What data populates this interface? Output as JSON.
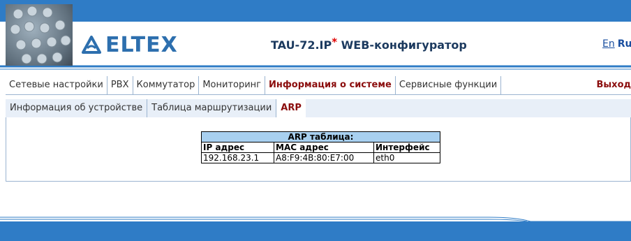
{
  "header": {
    "logo_text": "ELTEX",
    "app_title": "TAU-72.IP",
    "title_star": "*",
    "app_subtitle": " WEB-конфигуратор",
    "lang_en": "En",
    "lang_ru": "Ru"
  },
  "main_menu": [
    {
      "label": "Сетевые настройки",
      "active": false
    },
    {
      "label": "PBX",
      "active": false
    },
    {
      "label": "Коммутатор",
      "active": false
    },
    {
      "label": "Мониторинг",
      "active": false
    },
    {
      "label": "Информация о системе",
      "active": true
    },
    {
      "label": "Сервисные функции",
      "active": false
    }
  ],
  "exit_label": "Выход",
  "sub_menu": [
    {
      "label": "Информация об устройстве",
      "active": false
    },
    {
      "label": "Таблица маршрутизации",
      "active": false
    },
    {
      "label": "ARP",
      "active": true
    }
  ],
  "arp_table": {
    "caption": "ARP таблица:",
    "columns": [
      "IP адрес",
      "MAC адрес",
      "Интерфейс"
    ],
    "rows": [
      [
        "192.168.23.1",
        "A8:F9:4B:80:E7:00",
        "eth0"
      ]
    ]
  },
  "colors": {
    "brand_blue": "#2f7cc6",
    "logo_blue": "#2d6fae",
    "active_red": "#8b0d0d",
    "table_header": "#a8d0f0"
  }
}
